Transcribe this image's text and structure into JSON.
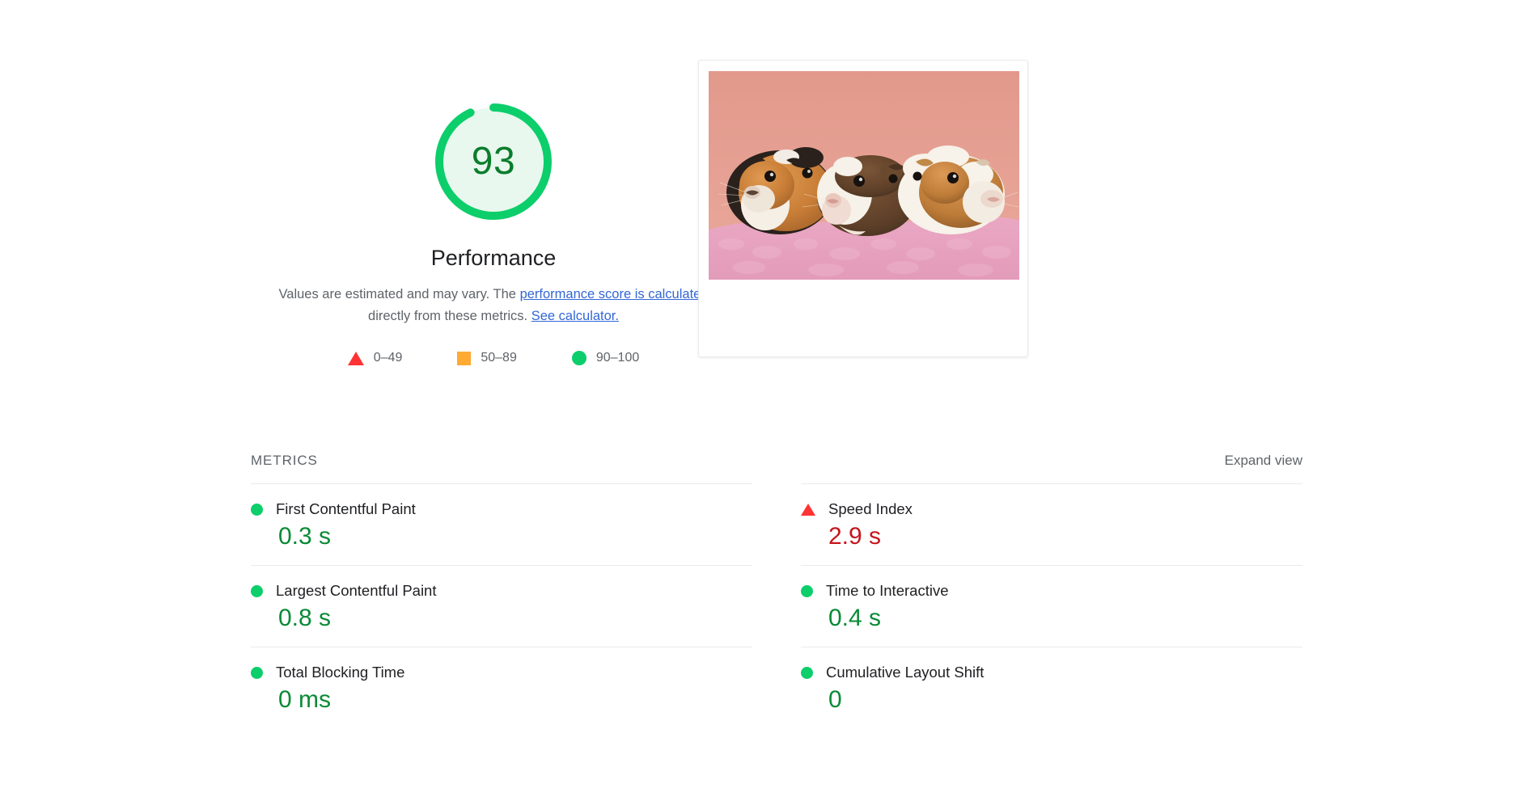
{
  "category": {
    "score": "93",
    "title": "Performance",
    "disclaimer_pre": "Values are estimated and may vary. The ",
    "disclaimer_link1": "performance score is calculated",
    "disclaimer_mid": " directly from these metrics. ",
    "disclaimer_link2": "See calculator.",
    "gauge_arc_color": "#0cce6b",
    "gauge_fill_color": "#e8f8ee",
    "gauge_score_color": "#0a7d2b"
  },
  "legend": {
    "items": [
      {
        "swatch": "fail-triangle",
        "label": "0–49"
      },
      {
        "swatch": "average-square",
        "label": "50–89"
      },
      {
        "swatch": "pass-circle",
        "label": "90–100"
      }
    ]
  },
  "screenshot": {
    "alt": "final-screenshot-thumbnail",
    "description": "Three guinea pigs sitting on a pink fleece blanket against a salmon pink background",
    "background_color": "#e39b8f",
    "blanket_color": "#e9a8c4"
  },
  "metrics_section": {
    "label": "METRICS",
    "expand_view_label": "Expand view",
    "metrics": [
      {
        "name": "First Contentful Paint",
        "value": "0.3 s",
        "rating": "pass"
      },
      {
        "name": "Speed Index",
        "value": "2.9 s",
        "rating": "fail"
      },
      {
        "name": "Largest Contentful Paint",
        "value": "0.8 s",
        "rating": "pass"
      },
      {
        "name": "Time to Interactive",
        "value": "0.4 s",
        "rating": "pass"
      },
      {
        "name": "Total Blocking Time",
        "value": "0 ms",
        "rating": "pass"
      },
      {
        "name": "Cumulative Layout Shift",
        "value": "0",
        "rating": "pass"
      }
    ]
  },
  "colors": {
    "pass": "#0cce6b",
    "average": "#ffaa33",
    "fail": "#ff3333",
    "pass_text": "#0a8a36",
    "fail_text": "#c4161c",
    "link": "#3367d6",
    "muted_text": "#5f6368",
    "divider": "#ebebeb"
  }
}
